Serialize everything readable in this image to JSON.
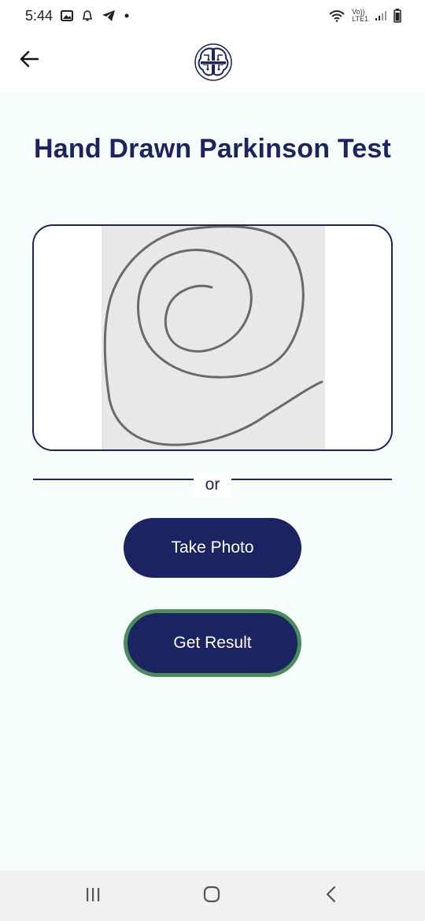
{
  "status_bar": {
    "time": "5:44",
    "lte_top": "Vo))",
    "lte_bottom": "LTE1"
  },
  "app_bar": {
    "back_icon": "arrow-left-icon",
    "logo_icon": "brain-logo-icon"
  },
  "page": {
    "title": "Hand Drawn Parkinson Test"
  },
  "divider": {
    "label": "or"
  },
  "buttons": {
    "take_photo": "Take Photo",
    "get_result": "Get Result"
  },
  "colors": {
    "primary": "#1b2360",
    "background": "#f6fffd",
    "result_border": "#4a8c5a"
  },
  "nav_bar": {
    "recents_icon": "recents-icon",
    "home_icon": "home-icon",
    "back_icon": "nav-back-icon"
  }
}
